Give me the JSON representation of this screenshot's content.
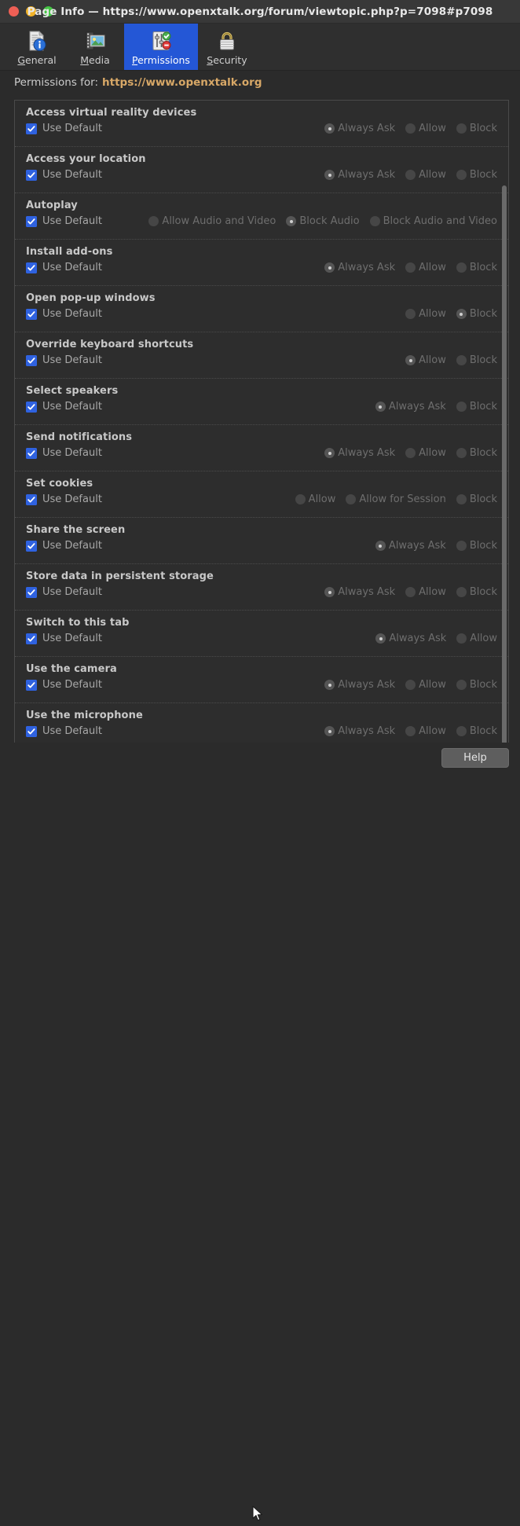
{
  "window": {
    "title": "Page Info — https://www.openxtalk.org/forum/viewtopic.php?p=7098#p7098",
    "controls": {
      "close": "close",
      "minimize": "minimize",
      "maximize": "maximize"
    }
  },
  "toolbar": {
    "tabs": [
      {
        "id": "general",
        "label": "General",
        "accel": "G",
        "icon": "document-info-icon",
        "selected": false
      },
      {
        "id": "media",
        "label": "Media",
        "accel": "M",
        "icon": "media-filmstrip-icon",
        "selected": false
      },
      {
        "id": "permissions",
        "label": "Permissions",
        "accel": "P",
        "icon": "permissions-sliders-icon",
        "selected": true
      },
      {
        "id": "security",
        "label": "Security",
        "accel": "S",
        "icon": "padlock-icon",
        "selected": false
      }
    ]
  },
  "permissions_header": {
    "label": "Permissions for:",
    "host": "https://www.openxtalk.org",
    "host_color": "#d8a867"
  },
  "use_default_label": "Use Default",
  "permissions": [
    {
      "name": "Access virtual reality devices",
      "use_default": true,
      "options": [
        {
          "label": "Always Ask",
          "selected": true
        },
        {
          "label": "Allow",
          "selected": false
        },
        {
          "label": "Block",
          "selected": false
        }
      ]
    },
    {
      "name": "Access your location",
      "use_default": true,
      "options": [
        {
          "label": "Always Ask",
          "selected": true
        },
        {
          "label": "Allow",
          "selected": false
        },
        {
          "label": "Block",
          "selected": false
        }
      ]
    },
    {
      "name": "Autoplay",
      "use_default": true,
      "options": [
        {
          "label": "Allow Audio and Video",
          "selected": false
        },
        {
          "label": "Block Audio",
          "selected": true
        },
        {
          "label": "Block Audio and Video",
          "selected": false
        }
      ]
    },
    {
      "name": "Install add-ons",
      "use_default": true,
      "options": [
        {
          "label": "Always Ask",
          "selected": true
        },
        {
          "label": "Allow",
          "selected": false
        },
        {
          "label": "Block",
          "selected": false
        }
      ]
    },
    {
      "name": "Open pop-up windows",
      "use_default": true,
      "options": [
        {
          "label": "Allow",
          "selected": false
        },
        {
          "label": "Block",
          "selected": true
        }
      ]
    },
    {
      "name": "Override keyboard shortcuts",
      "use_default": true,
      "options": [
        {
          "label": "Allow",
          "selected": true
        },
        {
          "label": "Block",
          "selected": false
        }
      ]
    },
    {
      "name": "Select speakers",
      "use_default": true,
      "options": [
        {
          "label": "Always Ask",
          "selected": true
        },
        {
          "label": "Block",
          "selected": false
        }
      ]
    },
    {
      "name": "Send notifications",
      "use_default": true,
      "options": [
        {
          "label": "Always Ask",
          "selected": true
        },
        {
          "label": "Allow",
          "selected": false
        },
        {
          "label": "Block",
          "selected": false
        }
      ]
    },
    {
      "name": "Set cookies",
      "use_default": true,
      "options": [
        {
          "label": "Allow",
          "selected": false
        },
        {
          "label": "Allow for Session",
          "selected": false
        },
        {
          "label": "Block",
          "selected": false
        }
      ]
    },
    {
      "name": "Share the screen",
      "use_default": true,
      "options": [
        {
          "label": "Always Ask",
          "selected": true
        },
        {
          "label": "Block",
          "selected": false
        }
      ]
    },
    {
      "name": "Store data in persistent storage",
      "use_default": true,
      "options": [
        {
          "label": "Always Ask",
          "selected": true
        },
        {
          "label": "Allow",
          "selected": false
        },
        {
          "label": "Block",
          "selected": false
        }
      ]
    },
    {
      "name": "Switch to this tab",
      "use_default": true,
      "options": [
        {
          "label": "Always Ask",
          "selected": true
        },
        {
          "label": "Allow",
          "selected": false
        }
      ]
    },
    {
      "name": "Use the camera",
      "use_default": true,
      "options": [
        {
          "label": "Always Ask",
          "selected": true
        },
        {
          "label": "Allow",
          "selected": false
        },
        {
          "label": "Block",
          "selected": false
        }
      ]
    },
    {
      "name": "Use the microphone",
      "use_default": true,
      "options": [
        {
          "label": "Always Ask",
          "selected": true
        },
        {
          "label": "Allow",
          "selected": false
        },
        {
          "label": "Block",
          "selected": false
        }
      ]
    }
  ],
  "scrollbar": {
    "thumb_top_pct": 13,
    "thumb_height_pct": 87
  },
  "footer": {
    "help_label": "Help"
  },
  "theme": {
    "window_bg": "#2b2b2b",
    "titlebar_bg": "#383838",
    "accent": "#2457d6",
    "checkbox": "#2f62e0",
    "list_bg": "#2d2d2d"
  }
}
